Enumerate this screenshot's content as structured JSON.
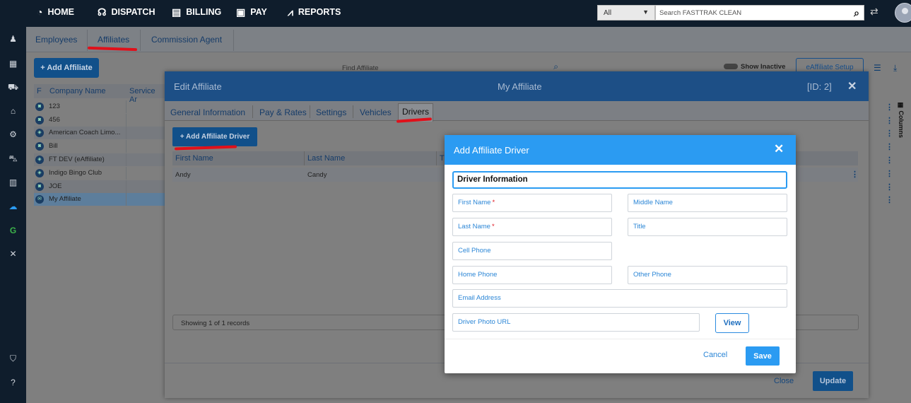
{
  "topnav": {
    "items": [
      {
        "label": "HOME",
        "icon": "dashboard-icon"
      },
      {
        "label": "DISPATCH",
        "icon": "headset-icon"
      },
      {
        "label": "BILLING",
        "icon": "document-icon"
      },
      {
        "label": "PAY",
        "icon": "money-icon"
      },
      {
        "label": "REPORTS",
        "icon": "chart-icon"
      }
    ],
    "scope_select": "All",
    "search_placeholder": "Search FASTTRAK CLEAN"
  },
  "subtabs": [
    "Employees",
    "Affiliates",
    "Commission Agent"
  ],
  "background": {
    "add_affiliate": "+ Add Affiliate",
    "find_placeholder": "Find Affiliate",
    "show_inactive": "Show Inactive",
    "eaffiliate_setup": "eAffiliate Setup",
    "columns_label": "Columns",
    "table_headers": [
      "F",
      "Company Name",
      "Service Ar"
    ],
    "rows": [
      "123",
      "456",
      "American Coach Limo...",
      "Bill",
      "FT DEV (eAffiliate)",
      "Indigo Bingo Club",
      "JOE",
      "My Affiliate"
    ]
  },
  "edit_modal": {
    "title": "Edit Affiliate",
    "center_title": "My Affiliate",
    "id_label": "[ID: 2]",
    "tabs": [
      "General Information",
      "Pay & Rates",
      "Settings",
      "Vehicles",
      "Drivers"
    ],
    "active_tab": "Drivers",
    "add_driver_button": "+ Add Affiliate Driver",
    "grid_headers": [
      "First Name",
      "Last Name",
      "T"
    ],
    "grid_row": {
      "first": "Andy",
      "last": "Candy"
    },
    "records": "Showing 1 of 1 records",
    "close": "Close",
    "update": "Update"
  },
  "dialog": {
    "title": "Add Affiliate Driver",
    "section": "Driver Information",
    "fields": {
      "first_name": "First Name",
      "middle_name": "Middle Name",
      "last_name": "Last Name",
      "title": "Title",
      "cell_phone": "Cell Phone",
      "home_phone": "Home Phone",
      "other_phone": "Other Phone",
      "email": "Email Address",
      "photo_url": "Driver Photo URL"
    },
    "required_mark": "*",
    "view": "View",
    "cancel": "Cancel",
    "save": "Save"
  },
  "colors": {
    "nav_bg": "#0f1d2c",
    "dialog_accent": "#2b9bf2",
    "annotation_red": "#e0101a"
  }
}
